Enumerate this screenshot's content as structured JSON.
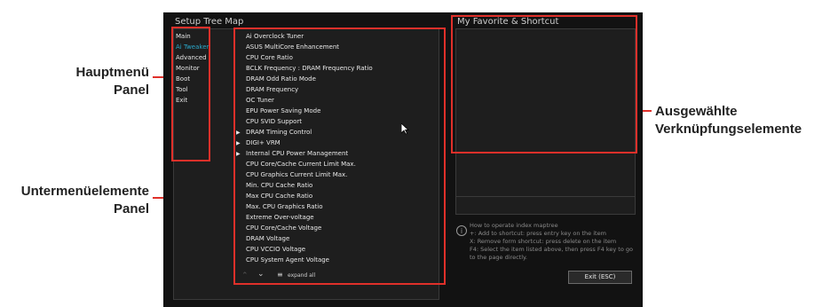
{
  "annotations": {
    "main_menu": [
      "Hauptmenü",
      "Panel"
    ],
    "submenu": [
      "Untermenüelemente",
      "Panel"
    ],
    "shortcut": [
      "Ausgewählte",
      "Verknüpfungselemente"
    ]
  },
  "window": {
    "title": "Setup Tree Map",
    "favorite_title": "My Favorite & Shortcut"
  },
  "main_menu": [
    "Main",
    "Ai Tweaker",
    "Advanced",
    "Monitor",
    "Boot",
    "Tool",
    "Exit"
  ],
  "submenu": [
    {
      "label": "Ai Overclock Tuner",
      "arrow": false
    },
    {
      "label": "ASUS MultiCore Enhancement",
      "arrow": false
    },
    {
      "label": "CPU Core Ratio",
      "arrow": false
    },
    {
      "label": "BCLK Frequency : DRAM Frequency Ratio",
      "arrow": false
    },
    {
      "label": "DRAM Odd Ratio Mode",
      "arrow": false
    },
    {
      "label": "DRAM Frequency",
      "arrow": false
    },
    {
      "label": "OC Tuner",
      "arrow": false
    },
    {
      "label": "EPU Power Saving Mode",
      "arrow": false
    },
    {
      "label": "CPU SVID Support",
      "arrow": false
    },
    {
      "label": "DRAM Timing Control",
      "arrow": true
    },
    {
      "label": "DIGI+ VRM",
      "arrow": true
    },
    {
      "label": "Internal CPU Power Management",
      "arrow": true
    },
    {
      "label": "CPU Core/Cache Current Limit Max.",
      "arrow": false
    },
    {
      "label": "CPU Graphics Current Limit Max.",
      "arrow": false
    },
    {
      "label": "Min. CPU Cache Ratio",
      "arrow": false
    },
    {
      "label": "Max CPU Cache Ratio",
      "arrow": false
    },
    {
      "label": "Max. CPU Graphics Ratio",
      "arrow": false
    },
    {
      "label": "Extreme Over-voltage",
      "arrow": false
    },
    {
      "label": "CPU Core/Cache Voltage",
      "arrow": false
    },
    {
      "label": "DRAM Voltage",
      "arrow": false
    },
    {
      "label": "CPU VCCIO Voltage",
      "arrow": false
    },
    {
      "label": "CPU System Agent Voltage",
      "arrow": false
    }
  ],
  "toolbar": {
    "expand_all": "expand all"
  },
  "help": {
    "heading": "How to operate index maptree",
    "lines": [
      "+: Add to shortcut: press entry key on the item",
      "X: Remove form shortcut: press delete on the item",
      "F4: Select the item listed above, then press F4 key to go to the page directly."
    ]
  },
  "exit_button": "Exit (ESC)",
  "colors": {
    "highlight": "#e0302a",
    "active_menu": "#2aa7c9"
  }
}
